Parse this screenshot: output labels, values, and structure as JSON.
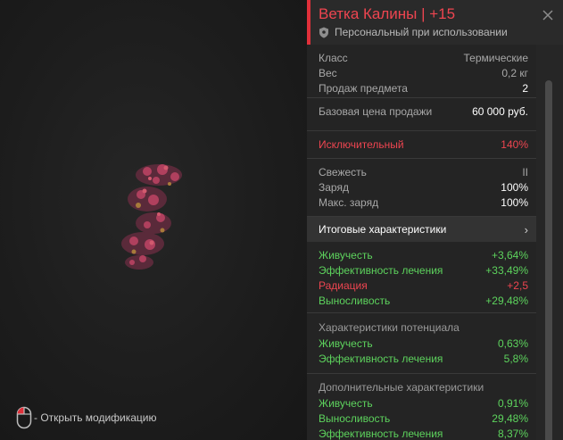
{
  "viewport": {
    "hint": "- Открыть модификацию"
  },
  "item": {
    "title": "Ветка Калины | +15",
    "subtitle": "Персональный при использовании"
  },
  "info": [
    {
      "label": "Класс",
      "value": "Термические"
    },
    {
      "label": "Вес",
      "value": "0,2 кг"
    },
    {
      "label": "Продаж предмета",
      "value": "2"
    }
  ],
  "price": {
    "label": "Базовая цена продажи",
    "value": "60 000 руб."
  },
  "rarity": {
    "label": "Исключительный",
    "value": "140%"
  },
  "state": [
    {
      "label": "Свежесть",
      "value": "II"
    },
    {
      "label": "Заряд",
      "value": "100%"
    },
    {
      "label": "Макс. заряд",
      "value": "100%"
    }
  ],
  "totals": {
    "title": "Итоговые характеристики",
    "chevron": "›",
    "rows": [
      {
        "label": "Живучесть",
        "value": "+3,64%",
        "tone": "green"
      },
      {
        "label": "Эффективность лечения",
        "value": "+33,49%",
        "tone": "green"
      },
      {
        "label": "Радиация",
        "value": "+2,5",
        "tone": "red"
      },
      {
        "label": "Выносливость",
        "value": "+29,48%",
        "tone": "green"
      }
    ]
  },
  "potential": {
    "title": "Характеристики потенциала",
    "rows": [
      {
        "label": "Живучесть",
        "value": "0,63%"
      },
      {
        "label": "Эффективность лечения",
        "value": "5,8%"
      }
    ]
  },
  "extra": {
    "title": "Дополнительные характеристики",
    "rows": [
      {
        "label": "Живучесть",
        "value": "0,91%"
      },
      {
        "label": "Выносливость",
        "value": "29,48%"
      },
      {
        "label": "Эффективность лечения",
        "value": "8,37%"
      }
    ]
  },
  "colors": {
    "accent": "#e0303a",
    "positive": "#5dd35d",
    "negative": "#ee4550"
  }
}
